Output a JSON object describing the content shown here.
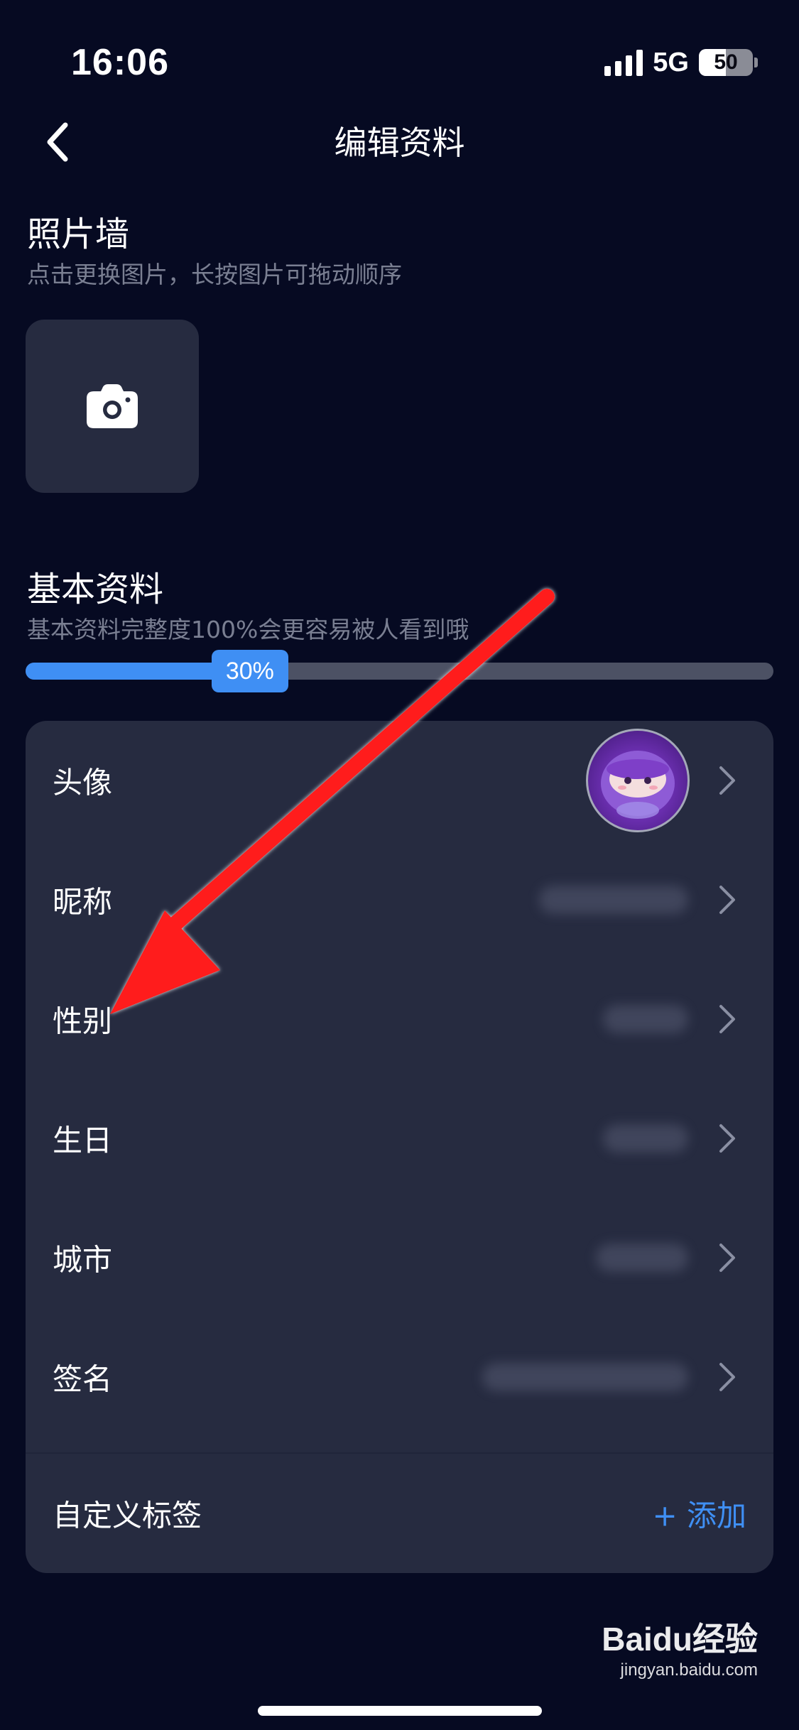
{
  "status_bar": {
    "time": "16:06",
    "network": "5G",
    "battery_percent": "50",
    "battery_level": 0.5,
    "signal_icon": "cellular-signal-icon"
  },
  "nav": {
    "back_icon": "chevron-left-icon",
    "title": "编辑资料"
  },
  "photo_wall": {
    "title": "照片墙",
    "subtitle": "点击更换图片，长按图片可拖动顺序",
    "add_icon": "camera-icon"
  },
  "basic_info": {
    "title": "基本资料",
    "subtitle": "基本资料完整度100%会更容易被人看到哦",
    "progress_label": "30%",
    "progress_value": 0.3
  },
  "profile_rows": [
    {
      "label": "头像"
    },
    {
      "label": "昵称"
    },
    {
      "label": "性别"
    },
    {
      "label": "生日"
    },
    {
      "label": "城市"
    },
    {
      "label": "签名"
    }
  ],
  "custom_tags": {
    "label": "自定义标签",
    "add_label": "+ 添加"
  },
  "colors": {
    "background": "#060a22",
    "card": "#262b40",
    "accent": "#3f8ff4",
    "annotation_arrow": "#ff1b1b"
  },
  "watermark": {
    "logo": "Baidu经验",
    "url": "jingyan.baidu.com"
  }
}
